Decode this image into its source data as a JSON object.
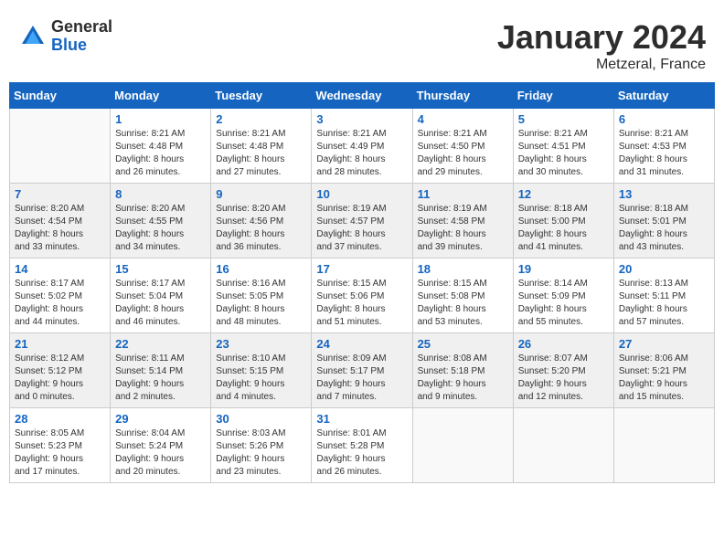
{
  "header": {
    "logo_general": "General",
    "logo_blue": "Blue",
    "month": "January 2024",
    "location": "Metzeral, France"
  },
  "weekdays": [
    "Sunday",
    "Monday",
    "Tuesday",
    "Wednesday",
    "Thursday",
    "Friday",
    "Saturday"
  ],
  "weeks": [
    [
      {
        "day": "",
        "info": ""
      },
      {
        "day": "1",
        "info": "Sunrise: 8:21 AM\nSunset: 4:48 PM\nDaylight: 8 hours\nand 26 minutes."
      },
      {
        "day": "2",
        "info": "Sunrise: 8:21 AM\nSunset: 4:48 PM\nDaylight: 8 hours\nand 27 minutes."
      },
      {
        "day": "3",
        "info": "Sunrise: 8:21 AM\nSunset: 4:49 PM\nDaylight: 8 hours\nand 28 minutes."
      },
      {
        "day": "4",
        "info": "Sunrise: 8:21 AM\nSunset: 4:50 PM\nDaylight: 8 hours\nand 29 minutes."
      },
      {
        "day": "5",
        "info": "Sunrise: 8:21 AM\nSunset: 4:51 PM\nDaylight: 8 hours\nand 30 minutes."
      },
      {
        "day": "6",
        "info": "Sunrise: 8:21 AM\nSunset: 4:53 PM\nDaylight: 8 hours\nand 31 minutes."
      }
    ],
    [
      {
        "day": "7",
        "info": "Sunrise: 8:20 AM\nSunset: 4:54 PM\nDaylight: 8 hours\nand 33 minutes."
      },
      {
        "day": "8",
        "info": "Sunrise: 8:20 AM\nSunset: 4:55 PM\nDaylight: 8 hours\nand 34 minutes."
      },
      {
        "day": "9",
        "info": "Sunrise: 8:20 AM\nSunset: 4:56 PM\nDaylight: 8 hours\nand 36 minutes."
      },
      {
        "day": "10",
        "info": "Sunrise: 8:19 AM\nSunset: 4:57 PM\nDaylight: 8 hours\nand 37 minutes."
      },
      {
        "day": "11",
        "info": "Sunrise: 8:19 AM\nSunset: 4:58 PM\nDaylight: 8 hours\nand 39 minutes."
      },
      {
        "day": "12",
        "info": "Sunrise: 8:18 AM\nSunset: 5:00 PM\nDaylight: 8 hours\nand 41 minutes."
      },
      {
        "day": "13",
        "info": "Sunrise: 8:18 AM\nSunset: 5:01 PM\nDaylight: 8 hours\nand 43 minutes."
      }
    ],
    [
      {
        "day": "14",
        "info": "Sunrise: 8:17 AM\nSunset: 5:02 PM\nDaylight: 8 hours\nand 44 minutes."
      },
      {
        "day": "15",
        "info": "Sunrise: 8:17 AM\nSunset: 5:04 PM\nDaylight: 8 hours\nand 46 minutes."
      },
      {
        "day": "16",
        "info": "Sunrise: 8:16 AM\nSunset: 5:05 PM\nDaylight: 8 hours\nand 48 minutes."
      },
      {
        "day": "17",
        "info": "Sunrise: 8:15 AM\nSunset: 5:06 PM\nDaylight: 8 hours\nand 51 minutes."
      },
      {
        "day": "18",
        "info": "Sunrise: 8:15 AM\nSunset: 5:08 PM\nDaylight: 8 hours\nand 53 minutes."
      },
      {
        "day": "19",
        "info": "Sunrise: 8:14 AM\nSunset: 5:09 PM\nDaylight: 8 hours\nand 55 minutes."
      },
      {
        "day": "20",
        "info": "Sunrise: 8:13 AM\nSunset: 5:11 PM\nDaylight: 8 hours\nand 57 minutes."
      }
    ],
    [
      {
        "day": "21",
        "info": "Sunrise: 8:12 AM\nSunset: 5:12 PM\nDaylight: 9 hours\nand 0 minutes."
      },
      {
        "day": "22",
        "info": "Sunrise: 8:11 AM\nSunset: 5:14 PM\nDaylight: 9 hours\nand 2 minutes."
      },
      {
        "day": "23",
        "info": "Sunrise: 8:10 AM\nSunset: 5:15 PM\nDaylight: 9 hours\nand 4 minutes."
      },
      {
        "day": "24",
        "info": "Sunrise: 8:09 AM\nSunset: 5:17 PM\nDaylight: 9 hours\nand 7 minutes."
      },
      {
        "day": "25",
        "info": "Sunrise: 8:08 AM\nSunset: 5:18 PM\nDaylight: 9 hours\nand 9 minutes."
      },
      {
        "day": "26",
        "info": "Sunrise: 8:07 AM\nSunset: 5:20 PM\nDaylight: 9 hours\nand 12 minutes."
      },
      {
        "day": "27",
        "info": "Sunrise: 8:06 AM\nSunset: 5:21 PM\nDaylight: 9 hours\nand 15 minutes."
      }
    ],
    [
      {
        "day": "28",
        "info": "Sunrise: 8:05 AM\nSunset: 5:23 PM\nDaylight: 9 hours\nand 17 minutes."
      },
      {
        "day": "29",
        "info": "Sunrise: 8:04 AM\nSunset: 5:24 PM\nDaylight: 9 hours\nand 20 minutes."
      },
      {
        "day": "30",
        "info": "Sunrise: 8:03 AM\nSunset: 5:26 PM\nDaylight: 9 hours\nand 23 minutes."
      },
      {
        "day": "31",
        "info": "Sunrise: 8:01 AM\nSunset: 5:28 PM\nDaylight: 9 hours\nand 26 minutes."
      },
      {
        "day": "",
        "info": ""
      },
      {
        "day": "",
        "info": ""
      },
      {
        "day": "",
        "info": ""
      }
    ]
  ]
}
